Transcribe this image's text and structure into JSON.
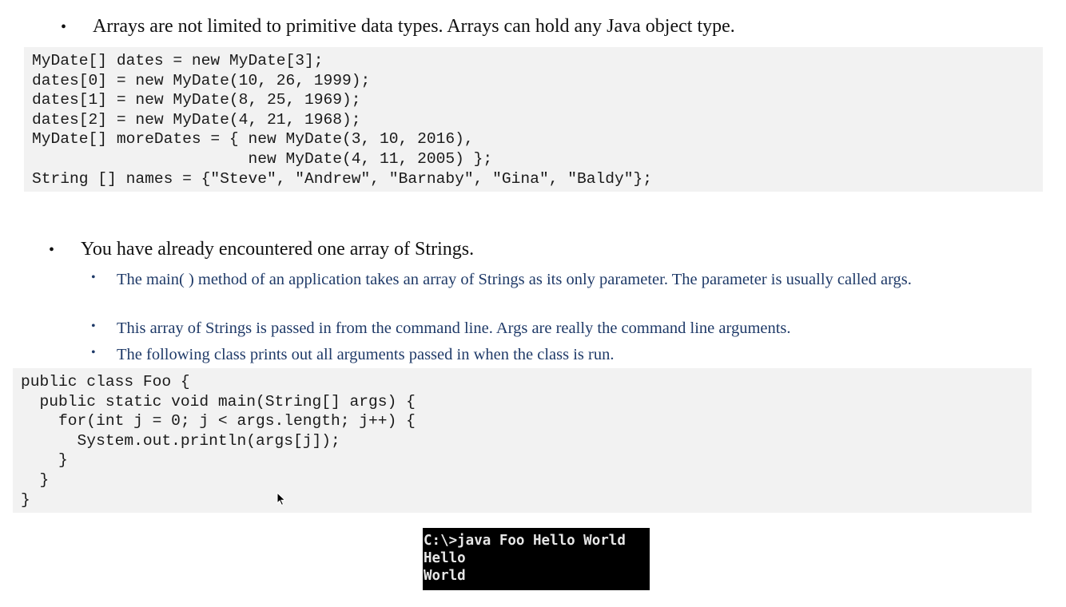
{
  "section1": {
    "bullet": "•",
    "text": "Arrays are not limited to primitive data types.  Arrays can hold any Java object type."
  },
  "code1": {
    "lines": [
      "MyDate[] dates = new MyDate[3];",
      "dates[0] = new MyDate(10, 26, 1999);",
      "dates[1] = new MyDate(8, 25, 1969);",
      "dates[2] = new MyDate(4, 21, 1968);",
      "MyDate[] moreDates = { new MyDate(3, 10, 2016),",
      "                       new MyDate(4, 11, 2005) };",
      "String [] names = {\"Steve\", \"Andrew\", \"Barnaby\", \"Gina\", \"Baldy\"};"
    ]
  },
  "section2": {
    "bullet": "•",
    "text": "You have already encountered one array of Strings.",
    "sub_bullet": "•",
    "subitems": [
      "The main( ) method of an application takes an array of Strings as its only parameter.  The parameter is usually called args.",
      "This array of Strings is passed in from the command line.  Args are really the command line arguments.",
      "The following class prints out all arguments passed in when the class is run."
    ]
  },
  "code2": {
    "lines": [
      "public class Foo {",
      "  public static void main(String[] args) {",
      "    for(int j = 0; j < args.length; j++) {",
      "      System.out.println(args[j]);",
      "    }",
      "  }",
      "}"
    ]
  },
  "console": {
    "lines": [
      "C:\\>java Foo Hello World",
      "Hello",
      "World"
    ]
  }
}
